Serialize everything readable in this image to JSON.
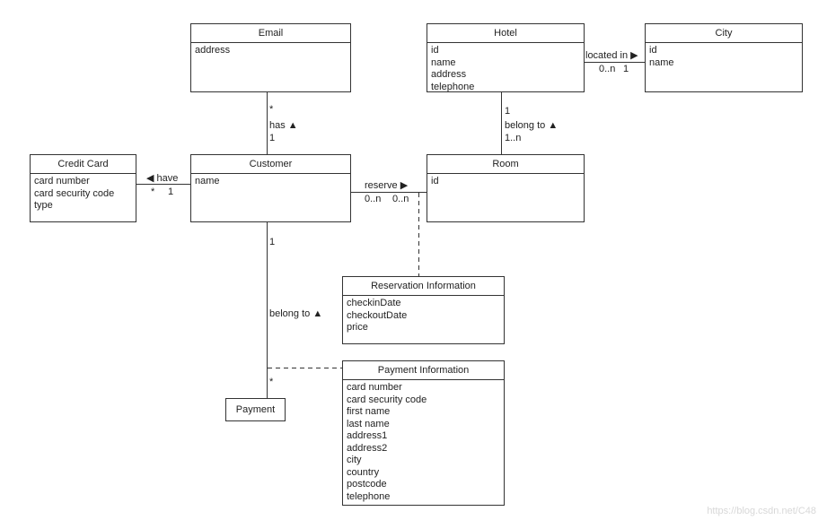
{
  "classes": {
    "email": {
      "name": "Email",
      "attributes": [
        "address"
      ]
    },
    "hotel": {
      "name": "Hotel",
      "attributes": [
        "id",
        "name",
        "address",
        "telephone"
      ]
    },
    "city": {
      "name": "City",
      "attributes": [
        "id",
        "name"
      ]
    },
    "credit_card": {
      "name": "Credit Card",
      "attributes": [
        "card number",
        "card security code",
        "type"
      ]
    },
    "customer": {
      "name": "Customer",
      "attributes": [
        "name"
      ]
    },
    "room": {
      "name": "Room",
      "attributes": [
        "id"
      ]
    },
    "reservation_information": {
      "name": "Reservation Information",
      "attributes": [
        "checkinDate",
        "checkoutDate",
        "price"
      ]
    },
    "payment_information": {
      "name": "Payment Information",
      "attributes": [
        "card number",
        "card security code",
        "first name",
        "last name",
        "address1",
        "address2",
        "city",
        "country",
        "postcode",
        "telephone"
      ]
    },
    "payment": {
      "name": "Payment",
      "attributes": []
    }
  },
  "associations": {
    "email_customer": {
      "label": "has ▲",
      "mult_email": "*",
      "mult_customer": "1"
    },
    "creditcard_customer": {
      "label": "◀ have",
      "mult_creditcard": "*",
      "mult_customer": "1"
    },
    "customer_room": {
      "label": "reserve ▶",
      "mult_customer": "0..n",
      "mult_room": "0..n"
    },
    "hotel_room": {
      "label": "belong to ▲",
      "mult_hotel": "1",
      "mult_room": "1..n"
    },
    "hotel_city": {
      "label": "located in ▶",
      "mult_hotel": "0..n",
      "mult_city": "1"
    },
    "customer_payment": {
      "label": "belong to ▲",
      "mult_customer": "1",
      "mult_payment": "*"
    }
  },
  "watermark": "https://blog.csdn.net/C48"
}
